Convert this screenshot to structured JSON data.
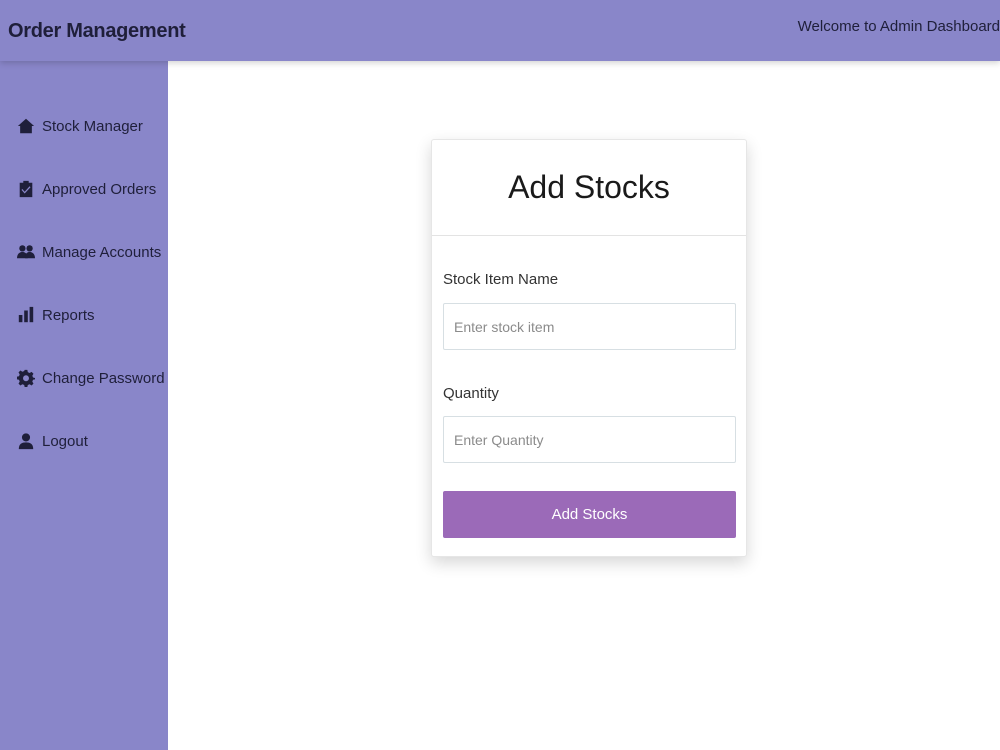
{
  "header": {
    "brand": "Order Management",
    "welcome": "Welcome to Admin Dashboard"
  },
  "sidebar": {
    "items": [
      {
        "label": "Stock Manager",
        "icon": "home-icon"
      },
      {
        "label": "Approved Orders",
        "icon": "clipboard-check-icon"
      },
      {
        "label": "Manage Accounts",
        "icon": "users-icon"
      },
      {
        "label": "Reports",
        "icon": "bar-chart-icon"
      },
      {
        "label": "Change Password",
        "icon": "gear-icon"
      },
      {
        "label": "Logout",
        "icon": "user-icon"
      }
    ]
  },
  "form": {
    "title": "Add Stocks",
    "stock_label": "Stock Item Name",
    "stock_placeholder": "Enter stock item",
    "stock_value": "",
    "quantity_label": "Quantity",
    "quantity_placeholder": "Enter Quantity",
    "quantity_value": "",
    "submit_label": "Add Stocks"
  },
  "colors": {
    "sidebar_bg": "#8986c9",
    "topbar_bg": "#8986c9",
    "button_bg": "#9b6ab8"
  }
}
